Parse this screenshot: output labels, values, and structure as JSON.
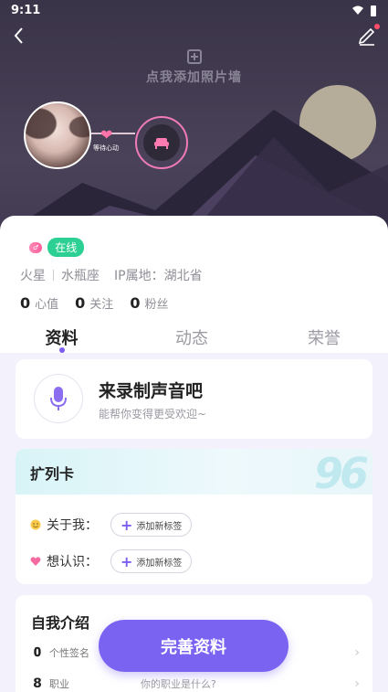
{
  "status_bar": {
    "time": "9:11"
  },
  "hero": {
    "add_photo_label": "点我添加照片墙",
    "wait_label": "等待心动"
  },
  "profile": {
    "gender_badge": "♂",
    "online_badge": "在线",
    "planet": "火星",
    "zodiac": "水瓶座",
    "ip_location": "IP属地：湖北省",
    "stats": [
      {
        "value": "0",
        "label": "心值"
      },
      {
        "value": "0",
        "label": "关注"
      },
      {
        "value": "0",
        "label": "粉丝"
      }
    ]
  },
  "tabs": [
    {
      "label": "资料",
      "active": true
    },
    {
      "label": "动态",
      "active": false
    },
    {
      "label": "荣誉",
      "active": false
    }
  ],
  "voice_card": {
    "title": "来录制声音吧",
    "subtitle": "能帮你变得更受欢迎~"
  },
  "kuolie_card": {
    "title": "扩列卡",
    "deco_text": "96",
    "rows": [
      {
        "label": "关于我：",
        "button": "添加新标签",
        "icon": "smile-icon"
      },
      {
        "label": "想认识：",
        "button": "添加新标签",
        "icon": "heart-icon"
      }
    ]
  },
  "intro_card": {
    "title": "自我介绍",
    "rows": [
      {
        "icon": "signature-icon",
        "glyph": "𝟎",
        "label": "个性签名",
        "value": ""
      },
      {
        "icon": "job-icon",
        "glyph": "8",
        "label": "职业",
        "value": "你的职业是什么?"
      }
    ]
  },
  "complete_button": "完善资料",
  "colors": {
    "accent": "#7b63f2",
    "online": "#2ccf94",
    "pink": "#ff74a8"
  }
}
